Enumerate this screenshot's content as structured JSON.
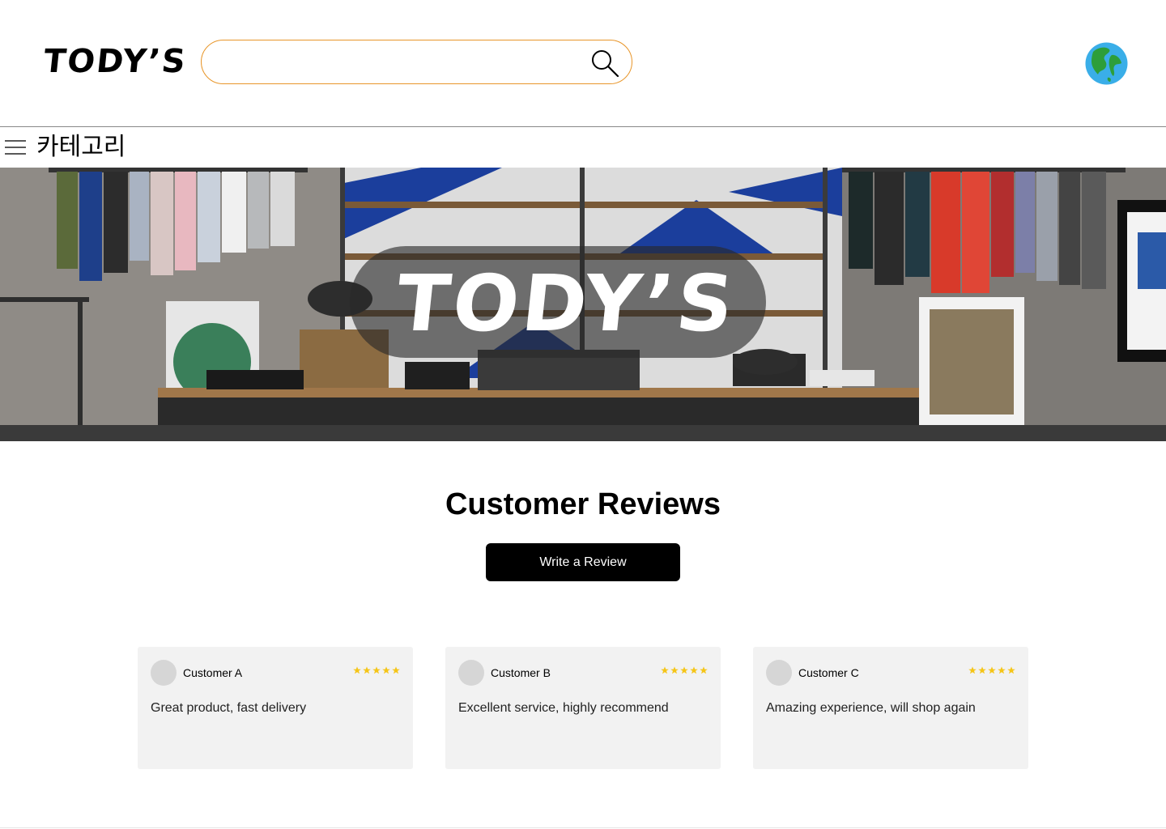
{
  "header": {
    "logo_text": "TODY’S",
    "search": {
      "placeholder": "",
      "value": ""
    },
    "search_icon": "search-icon",
    "globe_icon": "globe-icon"
  },
  "category_bar": {
    "menu_icon": "hamburger-menu-icon",
    "label": "카테고리"
  },
  "hero": {
    "title": "TODY’S"
  },
  "reviews": {
    "title": "Customer Reviews",
    "write_button_label": "Write a Review",
    "star_color": "#f5c518",
    "items": [
      {
        "name": "Customer A",
        "rating": 5,
        "text": "Great product, fast delivery"
      },
      {
        "name": "Customer B",
        "rating": 5,
        "text": "Excellent service, highly recommend"
      },
      {
        "name": "Customer C",
        "rating": 5,
        "text": "Amazing experience, will shop again"
      }
    ]
  },
  "colors": {
    "search_border": "#e8962a",
    "button_bg": "#000000",
    "card_bg": "#f2f2f2"
  }
}
